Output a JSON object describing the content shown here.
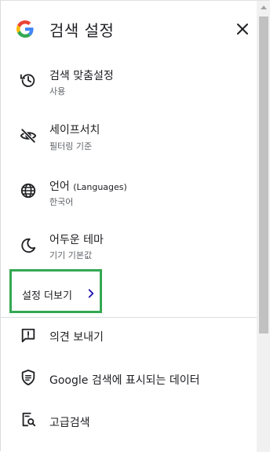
{
  "header": {
    "title": "검색 설정",
    "logo_icon": "google-g-logo",
    "close_icon": "close-icon"
  },
  "menu": [
    {
      "icon": "history-icon",
      "label": "검색 맞춤설정",
      "sublabel": "사용"
    },
    {
      "icon": "eye-off-icon",
      "label": "세이프서치",
      "sublabel": "필터링 기준"
    },
    {
      "icon": "globe-icon",
      "label": "언어",
      "label_extra": "(Languages)",
      "sublabel": "한국어"
    },
    {
      "icon": "moon-icon",
      "label": "어두운 테마",
      "sublabel": "기기 기본값"
    }
  ],
  "more_settings": {
    "label": "설정 더보기",
    "icon": "chevron-right-icon",
    "highlight_color": "#34a853"
  },
  "bottom_menu": [
    {
      "icon": "feedback-icon",
      "label": "의견 보내기"
    },
    {
      "icon": "shield-data-icon",
      "label": "Google 검색에 표시되는 데이터"
    },
    {
      "icon": "advanced-search-icon",
      "label": "고급검색"
    }
  ]
}
